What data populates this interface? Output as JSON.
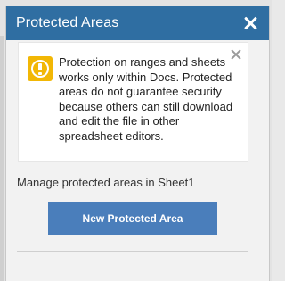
{
  "panel": {
    "title": "Protected Areas"
  },
  "notice": {
    "icon": "warning-icon",
    "text": "Protection on ranges and sheets works only within Docs. Protected areas do not guarantee security because others can still download and edit the file in other spreadsheet editors."
  },
  "main": {
    "manage_label": "Manage protected areas in Sheet1",
    "new_area_button": "New Protected Area"
  },
  "colors": {
    "header": "#2f6ea2",
    "button": "#4a7ebb",
    "warning": "#f2b705"
  }
}
